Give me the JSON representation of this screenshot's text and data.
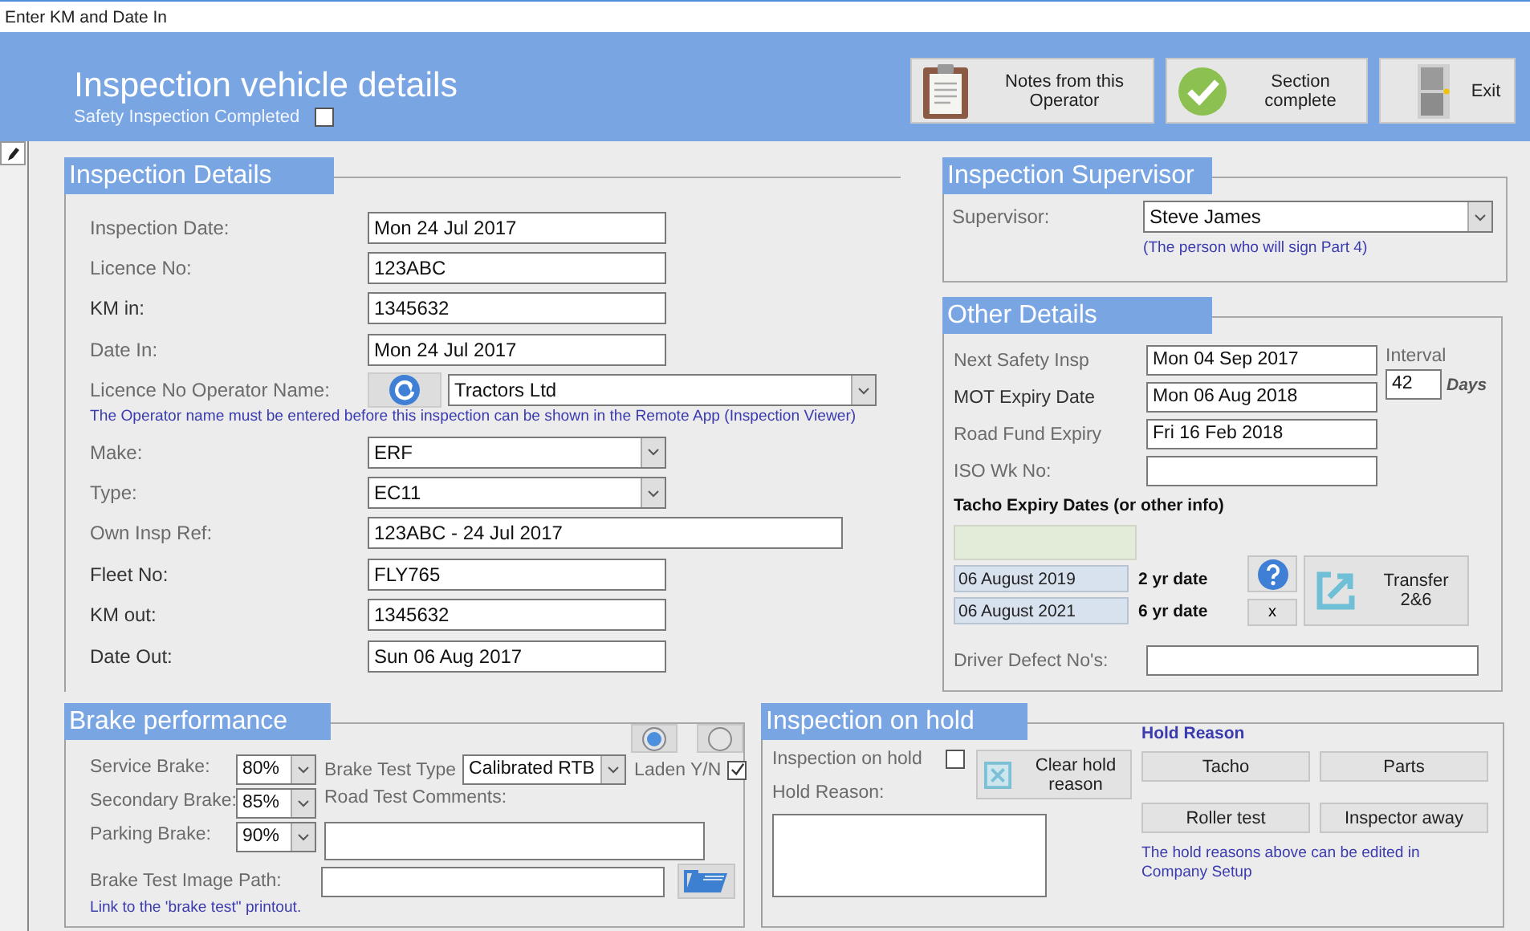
{
  "window": {
    "title": "Enter KM and Date In"
  },
  "header": {
    "title": "Inspection vehicle details",
    "completed": {
      "label": "Safety Inspection Completed",
      "checked": false
    },
    "buttons": [
      {
        "kind": "notes",
        "label": "Notes from this Operator"
      },
      {
        "kind": "complete",
        "label": "Section complete"
      },
      {
        "kind": "exit",
        "label": "Exit"
      }
    ]
  },
  "inspection_details": {
    "title": "Inspection Details",
    "rows": [
      {
        "kind": "text",
        "label": "Inspection Date:",
        "value": "Mon 24 Jul 2017",
        "emphasized": false
      },
      {
        "kind": "text",
        "label": "Licence No:",
        "value": "123ABC",
        "emphasized": false
      },
      {
        "kind": "text",
        "label": "KM in:",
        "value": "1345632",
        "emphasized": true
      },
      {
        "kind": "text",
        "label": "Date In:",
        "value": "Mon 24 Jul 2017",
        "emphasized": false
      },
      {
        "kind": "operator",
        "label": "Licence No Operator Name:",
        "value": "Tractors Ltd",
        "emphasized": false
      },
      {
        "kind": "note",
        "text": "The Operator name must be entered before this inspection can be shown in the  Remote App (Inspection Viewer)"
      },
      {
        "kind": "dropdown",
        "label": "Make:",
        "value": "ERF",
        "emphasized": false
      },
      {
        "kind": "dropdown",
        "label": "Type:",
        "value": "EC11",
        "emphasized": false
      },
      {
        "kind": "wide",
        "label": "Own Insp Ref:",
        "value": "123ABC - 24 Jul 2017",
        "emphasized": false
      },
      {
        "kind": "text",
        "label": "Fleet No:",
        "value": "FLY765",
        "emphasized": true
      },
      {
        "kind": "text",
        "label": "KM out:",
        "value": "1345632",
        "emphasized": true
      },
      {
        "kind": "text",
        "label": "Date Out:",
        "value": "Sun 06 Aug 2017",
        "emphasized": true
      }
    ]
  },
  "supervisor": {
    "title": "Inspection Supervisor",
    "label": "Supervisor:",
    "value": "Steve James",
    "note": "(The person who will sign Part 4)"
  },
  "other_details": {
    "title": "Other Details",
    "rows": [
      {
        "label": "Next Safety Insp",
        "value": "Mon 04 Sep 2017",
        "emphasized": false
      },
      {
        "label": "MOT Expiry Date",
        "value": "Mon 06 Aug 2018",
        "emphasized": true
      },
      {
        "label": "Road Fund Expiry",
        "value": "Fri 16 Feb 2018",
        "emphasized": false
      },
      {
        "label": "ISO Wk No:",
        "emphasized": false
      }
    ],
    "interval": {
      "label": "Interval",
      "value": "42",
      "unit": "Days"
    },
    "tacho_heading": "Tacho Expiry Dates (or other info)",
    "tacho_dates": [
      {
        "value": "06 August 2019",
        "label": "2 yr date"
      },
      {
        "value": "06 August 2021",
        "label": "6 yr date"
      }
    ],
    "clear_label": "x",
    "transfer_label": "Transfer 2&6",
    "defects_label": "Driver Defect No's:"
  },
  "brake": {
    "title": "Brake performance",
    "options": [
      {
        "selected": true
      },
      {
        "selected": false
      }
    ],
    "brakes": [
      {
        "label": "Service Brake:",
        "value": "80%"
      },
      {
        "label": "Secondary Brake:",
        "value": "85%"
      },
      {
        "label": "Parking Brake:",
        "value": "90%"
      }
    ],
    "test_type": {
      "label": "Brake Test Type",
      "value": "Calibrated RTB"
    },
    "laden": {
      "label": "Laden Y/N",
      "checked": true
    },
    "comments_label": "Road Test Comments:",
    "image_path_label": "Brake Test Image Path:",
    "link_note": "Link to the 'brake test\" printout."
  },
  "hold": {
    "title": "Inspection on hold",
    "on_hold": {
      "label": "Inspection on hold",
      "checked": false
    },
    "reason_label": "Hold Reason:",
    "clear_button": "Clear hold reason",
    "reasons_heading": "Hold Reason",
    "reasons": [
      "Tacho",
      "Parts",
      "Roller test",
      "Inspector away"
    ],
    "note": "The hold reasons above can be edited in Company Setup"
  }
}
